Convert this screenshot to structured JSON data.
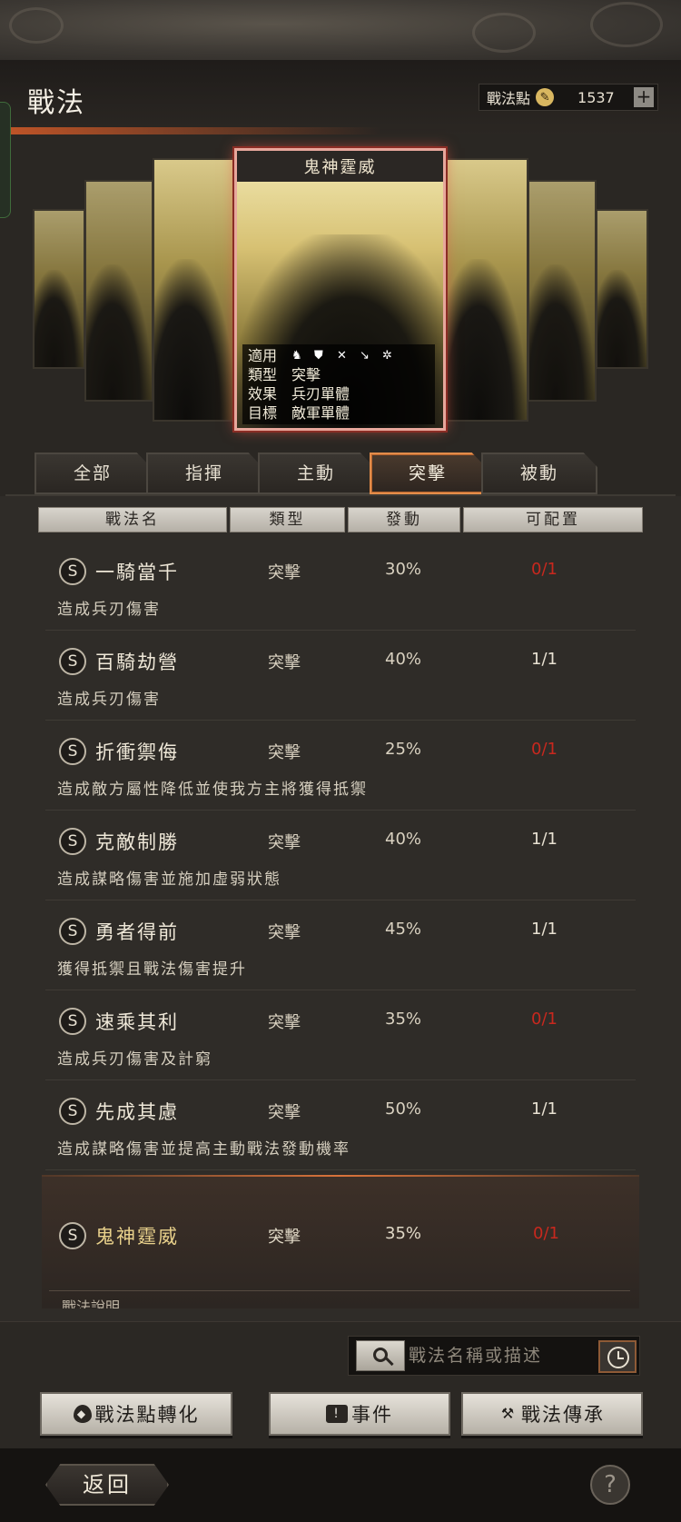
{
  "header": {
    "title": "戰法",
    "points_label": "戰法點",
    "points_value": "1537",
    "plus": "+"
  },
  "featured_card": {
    "title": "鬼神霆威",
    "rows": [
      {
        "key": "適用",
        "value": ""
      },
      {
        "key": "類型",
        "value": "突擊"
      },
      {
        "key": "效果",
        "value": "兵刃單體"
      },
      {
        "key": "目標",
        "value": "敵軍單體"
      }
    ],
    "unit_icons": [
      "cavalry-icon",
      "shield-icon",
      "bow-icon",
      "spear-icon",
      "wheel-icon"
    ]
  },
  "tabs": [
    "全部",
    "指揮",
    "主動",
    "突擊",
    "被動"
  ],
  "active_tab": "突擊",
  "columns": [
    "戰法名",
    "類型",
    "發動",
    "可配置"
  ],
  "tactics": [
    {
      "badge": "S",
      "name": "一騎當千",
      "type": "突擊",
      "rate": "30%",
      "available": "0/1",
      "desc": "造成兵刃傷害"
    },
    {
      "badge": "S",
      "name": "百騎劫營",
      "type": "突擊",
      "rate": "40%",
      "available": "1/1",
      "desc": "造成兵刃傷害"
    },
    {
      "badge": "S",
      "name": "折衝禦侮",
      "type": "突擊",
      "rate": "25%",
      "available": "0/1",
      "desc": "造成敵方屬性降低並使我方主將獲得抵禦"
    },
    {
      "badge": "S",
      "name": "克敵制勝",
      "type": "突擊",
      "rate": "40%",
      "available": "1/1",
      "desc": "造成謀略傷害並施加虛弱狀態"
    },
    {
      "badge": "S",
      "name": "勇者得前",
      "type": "突擊",
      "rate": "45%",
      "available": "1/1",
      "desc": "獲得抵禦且戰法傷害提升"
    },
    {
      "badge": "S",
      "name": "速乘其利",
      "type": "突擊",
      "rate": "35%",
      "available": "0/1",
      "desc": "造成兵刃傷害及計窮"
    },
    {
      "badge": "S",
      "name": "先成其慮",
      "type": "突擊",
      "rate": "50%",
      "available": "1/1",
      "desc": "造成謀略傷害並提高主動戰法發動機率"
    }
  ],
  "selected": {
    "badge": "S",
    "name": "鬼神霆威",
    "type": "突擊",
    "rate": "35%",
    "available": "0/1",
    "desc_label": "戰法說明"
  },
  "search": {
    "placeholder": "戰法名稱或描述"
  },
  "actions": {
    "convert": "戰法點轉化",
    "event": "事件",
    "inherit": "戰法傳承"
  },
  "footer": {
    "back": "返回",
    "help": "?"
  },
  "colors": {
    "accent": "#e28c4a",
    "unavailable": "#c8281e",
    "selected_name": "#ead28c"
  }
}
